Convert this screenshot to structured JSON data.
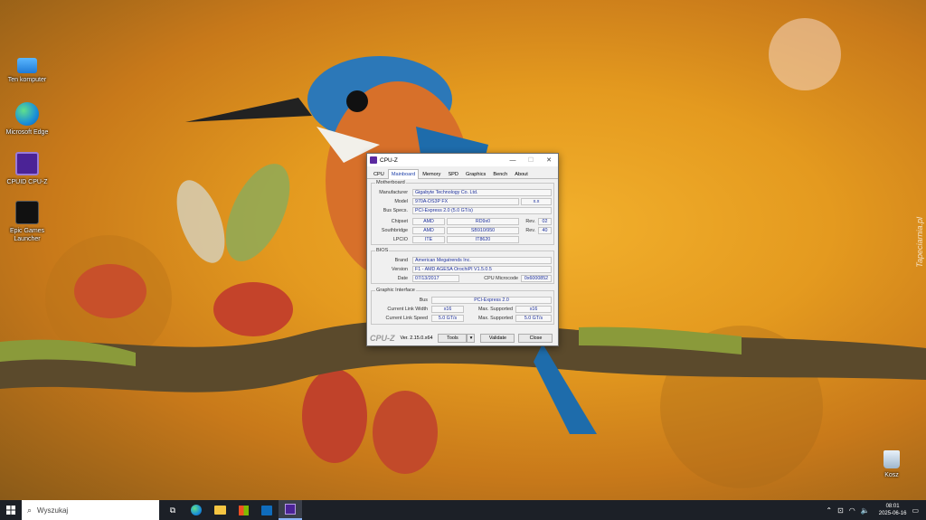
{
  "desktop": {
    "icons": [
      {
        "label": "Ten komputer"
      },
      {
        "label": "Microsoft Edge"
      },
      {
        "label": "CPUID CPU-Z"
      },
      {
        "label": "Epic Games Launcher"
      },
      {
        "label": "Kosz"
      }
    ],
    "watermark": "Tapeciarnia.pl"
  },
  "cpuz": {
    "title": "CPU-Z",
    "tabs": [
      "CPU",
      "Mainboard",
      "Memory",
      "SPD",
      "Graphics",
      "Bench",
      "About"
    ],
    "active_tab": "Mainboard",
    "motherboard": {
      "group_title": "Motherboard",
      "manufacturer_label": "Manufacturer",
      "manufacturer": "Gigabyte Technology Co. Ltd.",
      "model_label": "Model",
      "model": "970A-DS3P FX",
      "model_rev": "x.x",
      "bus_specs_label": "Bus Specs.",
      "bus_specs": "PCI-Express 2.0 (5.0 GT/s)",
      "chipset_label": "Chipset",
      "chipset_vendor": "AMD",
      "chipset_model": "RD9x0",
      "chipset_rev_label": "Rev.",
      "chipset_rev": "02",
      "southbridge_label": "Southbridge",
      "southbridge_vendor": "AMD",
      "southbridge_model": "SB910/950",
      "southbridge_rev_label": "Rev.",
      "southbridge_rev": "40",
      "lpcio_label": "LPCIO",
      "lpcio_vendor": "ITE",
      "lpcio_model": "IT8620"
    },
    "bios": {
      "group_title": "BIOS",
      "brand_label": "Brand",
      "brand": "American Megatrends Inc.",
      "version_label": "Version",
      "version": "F1 - AMD AGESA OrochiPI V1.5.0.5",
      "date_label": "Date",
      "date": "07/13/2017",
      "microcode_label": "CPU Microcode",
      "microcode": "0x6000852"
    },
    "graphic_interface": {
      "group_title": "Graphic Interface",
      "bus_label": "Bus",
      "bus": "PCI-Express 2.0",
      "link_width_label": "Current Link Width",
      "link_width": "x16",
      "max_width_label": "Max. Supported",
      "max_width": "x16",
      "link_speed_label": "Current Link Speed",
      "link_speed": "5.0 GT/s",
      "max_speed_label": "Max. Supported",
      "max_speed": "5.0 GT/s"
    },
    "footer": {
      "brand": "CPU-Z",
      "version": "Ver. 2.15.0.x64",
      "tools": "Tools",
      "validate": "Validate",
      "close": "Close"
    }
  },
  "taskbar": {
    "search_placeholder": "Wyszukaj",
    "time": "08:01",
    "date": "2025-06-16"
  },
  "colors": {
    "taskbar_bg": "#1c2027",
    "value_text": "#1d2f9c",
    "active_tab": "#1d3fa8"
  }
}
